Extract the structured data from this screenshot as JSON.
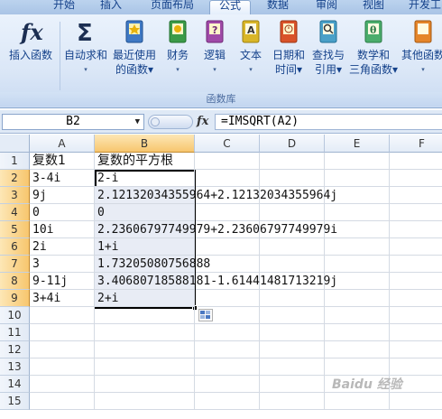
{
  "ribbon_tabs": [
    "开始",
    "插入",
    "页面布局",
    "公式",
    "数据",
    "审阅",
    "视图",
    "开发工"
  ],
  "active_tab": "公式",
  "ribbon_buttons": [
    {
      "icon": "fx-icon",
      "line1": "插入函数",
      "line2": ""
    },
    {
      "icon": "sigma-icon",
      "line1": "自动求和",
      "line2": "▾"
    },
    {
      "icon": "star-book-icon",
      "line1": "最近使用",
      "line2": "的函数▾"
    },
    {
      "icon": "finance-book-icon",
      "line1": "财务",
      "line2": "▾"
    },
    {
      "icon": "logic-book-icon",
      "line1": "逻辑",
      "line2": "▾"
    },
    {
      "icon": "text-book-icon",
      "line1": "文本",
      "line2": "▾"
    },
    {
      "icon": "datetime-book-icon",
      "line1": "日期和",
      "line2": "时间▾"
    },
    {
      "icon": "lookup-book-icon",
      "line1": "查找与",
      "line2": "引用▾"
    },
    {
      "icon": "math-book-icon",
      "line1": "数学和",
      "line2": "三角函数▾"
    },
    {
      "icon": "more-book-icon",
      "line1": "其他函数",
      "line2": "▾"
    }
  ],
  "group_label": "函数库",
  "name_box": "B2",
  "fx_label": "fx",
  "formula": "=IMSQRT(A2)",
  "columns": [
    "A",
    "B",
    "C",
    "D",
    "E",
    "F"
  ],
  "rows": [
    {
      "n": "1",
      "a": "复数1",
      "b": "复数的平方根"
    },
    {
      "n": "2",
      "a": "3-4i",
      "b": "2-i"
    },
    {
      "n": "3",
      "a": "9j",
      "b": "2.12132034355964+2.12132034355964j"
    },
    {
      "n": "4",
      "a": "0",
      "b": "0"
    },
    {
      "n": "5",
      "a": "10i",
      "b": "2.23606797749979+2.23606797749979i"
    },
    {
      "n": "6",
      "a": "2i",
      "b": "1+i"
    },
    {
      "n": "7",
      "a": "3",
      "b": "1.73205080756888"
    },
    {
      "n": "8",
      "a": "9-11j",
      "b": "3.40680718588181-1.61441481713219j"
    },
    {
      "n": "9",
      "a": "3+4i",
      "b": "2+i"
    },
    {
      "n": "10",
      "a": "",
      "b": ""
    },
    {
      "n": "11",
      "a": "",
      "b": ""
    },
    {
      "n": "12",
      "a": "",
      "b": ""
    },
    {
      "n": "13",
      "a": "",
      "b": ""
    },
    {
      "n": "14",
      "a": "",
      "b": ""
    },
    {
      "n": "15",
      "a": "",
      "b": ""
    }
  ],
  "watermark": "Baidu 经验"
}
